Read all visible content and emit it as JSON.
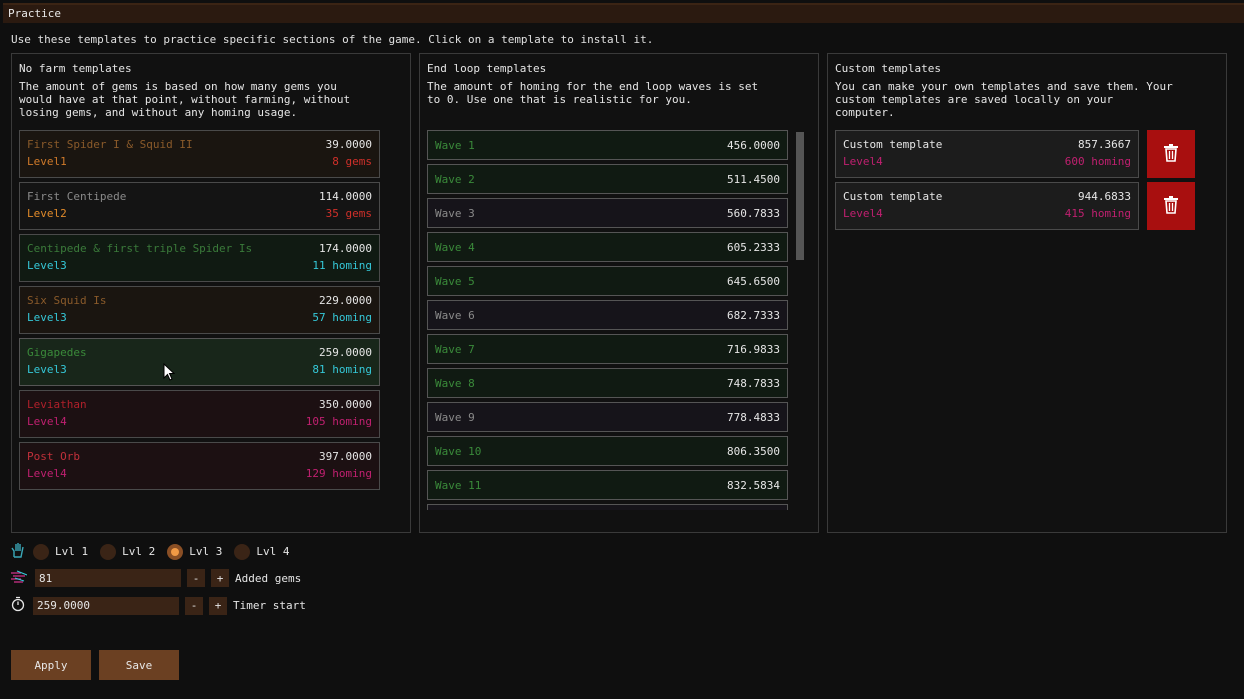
{
  "window": {
    "title": "Practice"
  },
  "intro": "Use these templates to practice specific sections of the game. Click on a template to install it.",
  "no_farm": {
    "title": "No farm templates",
    "desc": "The amount of gems is based on how many gems you\nwould have at that point, without farming, without\nlosing gems, and without any homing usage.",
    "items": [
      {
        "name": "First Spider I & Squid II",
        "value": "39.0000",
        "level": "Level1",
        "extra": "8 gems",
        "name_color": "#8a5a2a",
        "level_color": "#d07a2a",
        "extra_color": "#d0302a",
        "bg": "#1a1510",
        "border": "#4a4a4a"
      },
      {
        "name": "First Centipede",
        "value": "114.0000",
        "level": "Level2",
        "extra": "35 gems",
        "name_color": "#8a8a8a",
        "level_color": "#e08a2a",
        "extra_color": "#d0302a",
        "bg": "#141414",
        "border": "#4a4a4a"
      },
      {
        "name": "Centipede & first triple Spider Is",
        "value": "174.0000",
        "level": "Level3",
        "extra": "11 homing",
        "name_color": "#3a7a3a",
        "level_color": "#35c8d8",
        "extra_color": "#35c8d8",
        "bg": "#101a12",
        "border": "#4a4a4a"
      },
      {
        "name": "Six Squid Is",
        "value": "229.0000",
        "level": "Level3",
        "extra": "57 homing",
        "name_color": "#8a5a2a",
        "level_color": "#35c8d8",
        "extra_color": "#35c8d8",
        "bg": "#1a1510",
        "border": "#4a4a4a"
      },
      {
        "name": "Gigapedes",
        "value": "259.0000",
        "level": "Level3",
        "extra": "81 homing",
        "name_color": "#3a8a3a",
        "level_color": "#35c8d8",
        "extra_color": "#35c8d8",
        "bg": "#18261a",
        "border": "#555555"
      },
      {
        "name": "Leviathan",
        "value": "350.0000",
        "level": "Level4",
        "extra": "105 homing",
        "name_color": "#b0202a",
        "level_color": "#c02070",
        "extra_color": "#c02070",
        "bg": "#1c1012",
        "border": "#4a4a4a"
      },
      {
        "name": "Post Orb",
        "value": "397.0000",
        "level": "Level4",
        "extra": "129 homing",
        "name_color": "#c0303a",
        "level_color": "#c02070",
        "extra_color": "#c02070",
        "bg": "#1c1012",
        "border": "#4a4a4a"
      }
    ]
  },
  "end_loop": {
    "title": "End loop templates",
    "desc": "The amount of homing for the end loop waves is set\nto 0. Use one that is realistic for you.",
    "waves": [
      {
        "name": "Wave 1",
        "value": "456.0000",
        "name_color": "#3a8a3a",
        "bg": "#101a12"
      },
      {
        "name": "Wave 2",
        "value": "511.4500",
        "name_color": "#3a8a3a",
        "bg": "#101a12"
      },
      {
        "name": "Wave 3",
        "value": "560.7833",
        "name_color": "#8a8a8a",
        "bg": "#16141a"
      },
      {
        "name": "Wave 4",
        "value": "605.2333",
        "name_color": "#3a8a3a",
        "bg": "#101a12"
      },
      {
        "name": "Wave 5",
        "value": "645.6500",
        "name_color": "#3a8a3a",
        "bg": "#101a12"
      },
      {
        "name": "Wave 6",
        "value": "682.7333",
        "name_color": "#8a8a8a",
        "bg": "#16141a"
      },
      {
        "name": "Wave 7",
        "value": "716.9833",
        "name_color": "#3a8a3a",
        "bg": "#101a12"
      },
      {
        "name": "Wave 8",
        "value": "748.7833",
        "name_color": "#3a8a3a",
        "bg": "#101a12"
      },
      {
        "name": "Wave 9",
        "value": "778.4833",
        "name_color": "#8a8a8a",
        "bg": "#16141a"
      },
      {
        "name": "Wave 10",
        "value": "806.3500",
        "name_color": "#3a8a3a",
        "bg": "#101a12"
      },
      {
        "name": "Wave 11",
        "value": "832.5834",
        "name_color": "#3a8a3a",
        "bg": "#101a12"
      },
      {
        "name": "",
        "value": "",
        "name_color": "#8a8a8a",
        "bg": "#16141a"
      }
    ]
  },
  "custom": {
    "title": "Custom templates",
    "desc": "You can make your own templates and save them. Your\ncustom templates are saved locally on your\ncomputer.",
    "items": [
      {
        "name": "Custom template",
        "value": "857.3667",
        "level": "Level4",
        "extra": "600 homing"
      },
      {
        "name": "Custom template",
        "value": "944.6833",
        "level": "Level4",
        "extra": "415 homing"
      }
    ]
  },
  "level_select": {
    "options": [
      "Lvl 1",
      "Lvl 2",
      "Lvl 3",
      "Lvl 4"
    ],
    "selected": "Lvl 3"
  },
  "added_gems": {
    "value": "81",
    "minus": "-",
    "plus": "+",
    "label": "Added gems"
  },
  "timer_start": {
    "value": "259.0000",
    "minus": "-",
    "plus": "+",
    "label": "Timer start"
  },
  "actions": {
    "apply": "Apply",
    "save": "Save"
  },
  "colors": {
    "accent": "#6b4022",
    "danger": "#a80f0f",
    "level4": "#c02070",
    "level3": "#35c8d8"
  }
}
